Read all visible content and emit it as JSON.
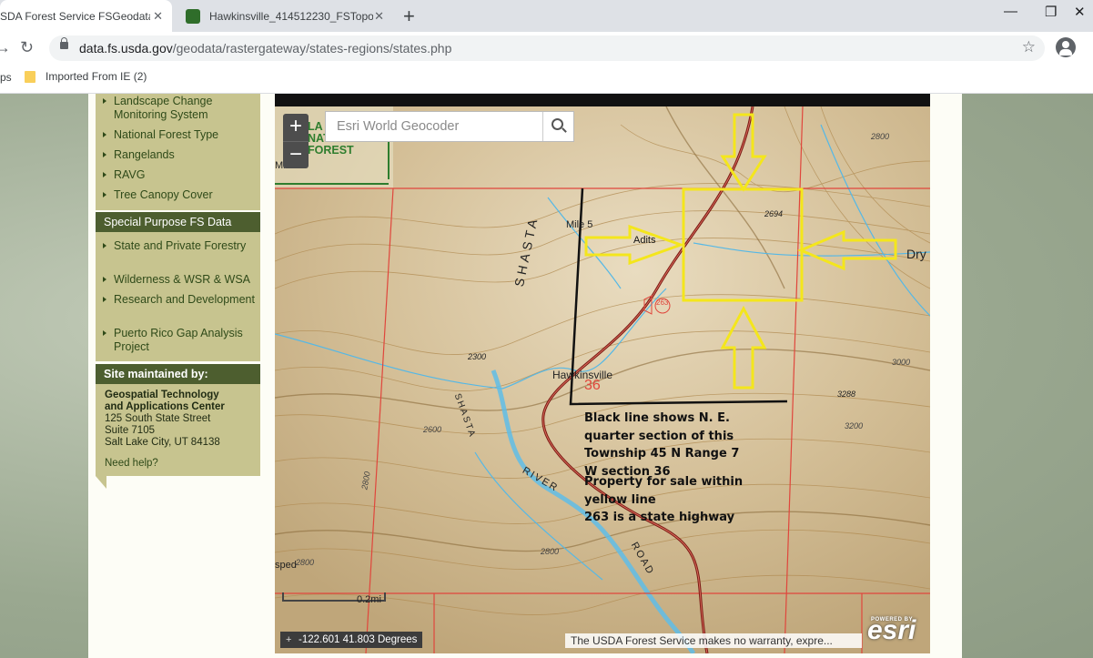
{
  "browser": {
    "tabs": [
      {
        "title": "SDA Forest Service FSGeodata C",
        "active": true
      },
      {
        "title": "Hawkinsville_414512230_FSTopo",
        "active": false
      }
    ],
    "new_tab_glyph": "+",
    "url_host": "data.fs.usda.gov",
    "url_path": "/geodata/rastergateway/states-regions/states.php",
    "bookmarks": [
      {
        "label": "ps"
      },
      {
        "label": "Imported From IE (2)"
      }
    ],
    "icons": [
      "back-arrow-icon",
      "reload-icon",
      "lock-icon",
      "star-icon",
      "profile-icon",
      "folder-icon"
    ],
    "accent": "#dee1e6"
  },
  "sidebar": {
    "top_items": [
      "Landscape Change Monitoring System",
      "National Forest Type",
      "Rangelands",
      "RAVG",
      "Tree Canopy Cover"
    ],
    "special_header": "Special Purpose FS Data",
    "special_items": [
      "State and Private Forestry",
      "Wilderness & WSR & WSA",
      "Research and Development",
      "Puerto Rico Gap Analysis Project"
    ],
    "maintained_header": "Site maintained by:",
    "org_line1": "Geospatial Technology",
    "org_line2": "and Applications Center",
    "address1": "125 South State Street",
    "address2": "Suite 7105",
    "address3": "Salt Lake City, UT 84138",
    "help": "Need help?",
    "colors": {
      "panel": "#c7c48f",
      "header": "#4d5e2f",
      "link": "#2f4a19"
    }
  },
  "map": {
    "zoom_in": "+",
    "zoom_out": "−",
    "search_placeholder": "Esri World Geocoder",
    "forest_lines": [
      "LA",
      "NATIONAL",
      "FOREST"
    ],
    "labels": {
      "mile5": "Mile 5",
      "adits": "Adits",
      "shasta": "SHASTA",
      "hawkinsville": "Hawkinsville",
      "section": "36",
      "dry": "Dry",
      "river": "RIVER",
      "road": "ROAD",
      "mine": "Mine",
      "sped": "sped",
      "shasta_small": "SHASTA",
      "hwy": "263"
    },
    "elevations": [
      "2800",
      "2694",
      "2300",
      "2600",
      "3288",
      "3200",
      "3000",
      "2800",
      "2800",
      "2800"
    ],
    "annotation_black": [
      "Black line shows N. E.",
      "quarter section of this",
      "Township 45 N Range 7",
      "W section 36"
    ],
    "annotation_property": [
      "Property for sale within",
      "yellow line",
      "263 is a state highway"
    ],
    "scale": "0.2mi",
    "coordinates": "-122.601 41.803 Degrees",
    "attribution": "The USDA Forest Service makes no warranty, expre...",
    "powered_by": "POWERED BY",
    "esri": "esri",
    "colors": {
      "terrain": "#cfb98f",
      "grid": "#e0463c",
      "water": "#55b8e6",
      "highway": "#7a1a14",
      "highlight": "#f4e61c"
    }
  }
}
